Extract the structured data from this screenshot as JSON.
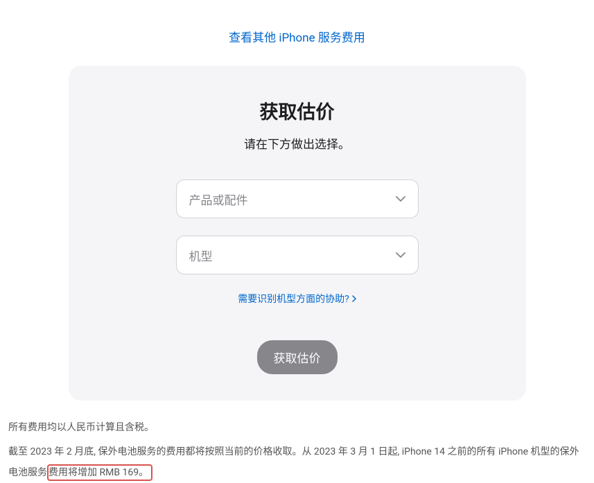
{
  "header": {
    "other_link": "查看其他 iPhone 服务费用"
  },
  "card": {
    "title": "获取估价",
    "subtitle": "请在下方做出选择。",
    "product_placeholder": "产品或配件",
    "model_placeholder": "机型",
    "help_link": "需要识别机型方面的协助?",
    "submit_label": "获取估价"
  },
  "footer": {
    "line1": "所有费用均以人民币计算且含税。",
    "line2_before": "截至 2023 年 2 月底, 保外电池服务的费用都将按照当前的价格收取。从 2023 年 3 月 1 日起, iPhone 14 之前的所有 iPhone 机型的保外电池服务",
    "line2_highlight": "费用将增加 RMB 169。"
  }
}
